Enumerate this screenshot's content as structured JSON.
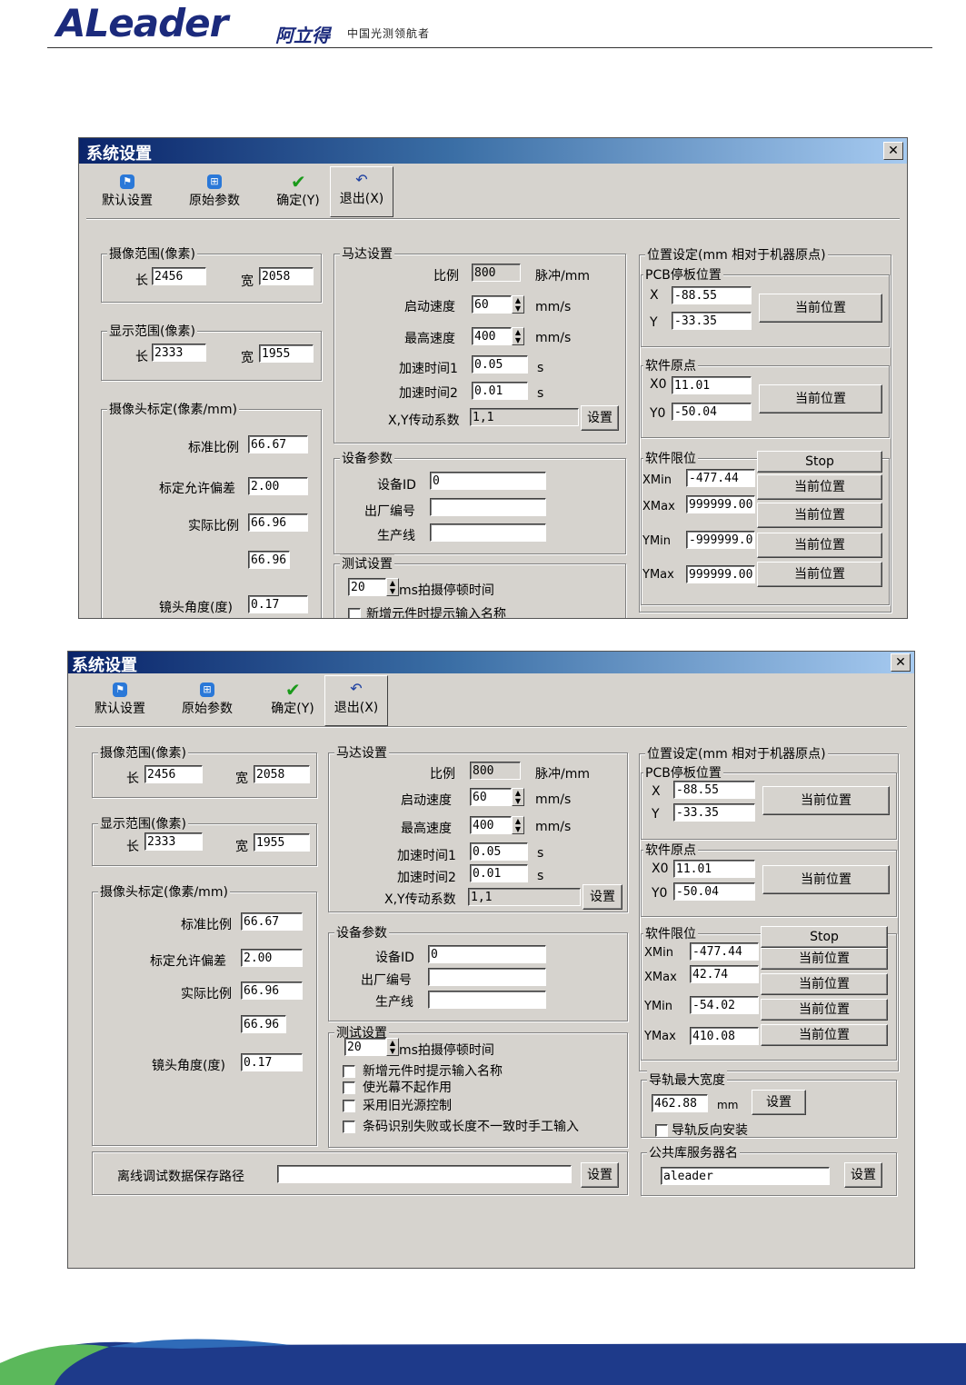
{
  "header": {
    "logo": "ALeader",
    "brand_cn": "阿立得",
    "tagline": "中国光测领航者"
  },
  "win1": {
    "title": "系统设置",
    "close": "✕",
    "toolbar": {
      "default_label": "默认设置",
      "original_label": "原始参数",
      "confirm_label": "确定(Y)",
      "exit_label": "退出(X)"
    },
    "camera_range": {
      "title": "摄像范围(像素)",
      "len_label": "长",
      "len_value": "2456",
      "wid_label": "宽",
      "wid_value": "2058"
    },
    "display_range": {
      "title": "显示范围(像素)",
      "len_label": "长",
      "len_value": "2333",
      "wid_label": "宽",
      "wid_value": "1955"
    },
    "calib": {
      "title": "摄像头标定(像素/mm)",
      "std_label": "标准比例",
      "std_value": "66.67",
      "tol_label": "标定允许偏差",
      "tol_value": "2.00",
      "act_label": "实际比例",
      "act_value": "66.96",
      "act2_value": "66.96",
      "angle_label": "镜头角度(度)",
      "angle_value": "0.17"
    },
    "motor": {
      "title": "马达设置",
      "ratio_label": "比例",
      "ratio_value": "800",
      "ratio_unit": "脉冲/mm",
      "start_label": "启动速度",
      "start_value": "60",
      "start_unit": "mm/s",
      "max_label": "最高速度",
      "max_value": "400",
      "max_unit": "mm/s",
      "acc1_label": "加速时间1",
      "acc1_value": "0.05",
      "acc1_unit": "s",
      "acc2_label": "加速时间2",
      "acc2_value": "0.01",
      "acc2_unit": "s",
      "xy_label": "X,Y传动系数",
      "xy_value": "1,1",
      "set_label": "设置"
    },
    "device": {
      "title": "设备参数",
      "id_label": "设备ID",
      "id_value": "0",
      "serial_label": "出厂编号",
      "serial_value": "",
      "line_label": "生产线",
      "line_value": ""
    },
    "test": {
      "title": "测试设置",
      "pause_value": "20",
      "pause_label": "ms拍摄停顿时间",
      "cb1": "新增元件时提示输入名称"
    },
    "position": {
      "title": "位置设定(mm 相对于机器原点)",
      "pcb_title": "PCB停板位置",
      "x_label": "X",
      "x_value": "-88.55",
      "y_label": "Y",
      "y_value": "-33.35",
      "cur_label": "当前位置",
      "origin_title": "软件原点",
      "x0_label": "X0",
      "x0_value": "11.01",
      "y0_label": "Y0",
      "y0_value": "-50.04",
      "limit_title": "软件限位",
      "stop_label": "Stop",
      "xmin_label": "XMin",
      "xmin_value": "-477.44",
      "xmax_label": "XMax",
      "xmax_value": "999999.00",
      "ymin_label": "YMin",
      "ymin_value": "-999999.0",
      "ymax_label": "YMax",
      "ymax_value": "999999.00"
    }
  },
  "win2": {
    "title": "系统设置",
    "close": "✕",
    "toolbar": {
      "default_label": "默认设置",
      "original_label": "原始参数",
      "confirm_label": "确定(Y)",
      "exit_label": "退出(X)"
    },
    "camera_range": {
      "title": "摄像范围(像素)",
      "len_label": "长",
      "len_value": "2456",
      "wid_label": "宽",
      "wid_value": "2058"
    },
    "display_range": {
      "title": "显示范围(像素)",
      "len_label": "长",
      "len_value": "2333",
      "wid_label": "宽",
      "wid_value": "1955"
    },
    "calib": {
      "title": "摄像头标定(像素/mm)",
      "std_label": "标准比例",
      "std_value": "66.67",
      "tol_label": "标定允许偏差",
      "tol_value": "2.00",
      "act_label": "实际比例",
      "act_value": "66.96",
      "act2_value": "66.96",
      "angle_label": "镜头角度(度)",
      "angle_value": "0.17"
    },
    "motor": {
      "title": "马达设置",
      "ratio_label": "比例",
      "ratio_value": "800",
      "ratio_unit": "脉冲/mm",
      "start_label": "启动速度",
      "start_value": "60",
      "start_unit": "mm/s",
      "max_label": "最高速度",
      "max_value": "400",
      "max_unit": "mm/s",
      "acc1_label": "加速时间1",
      "acc1_value": "0.05",
      "acc1_unit": "s",
      "acc2_label": "加速时间2",
      "acc2_value": "0.01",
      "acc2_unit": "s",
      "xy_label": "X,Y传动系数",
      "xy_value": "1,1",
      "set_label": "设置"
    },
    "device": {
      "title": "设备参数",
      "id_label": "设备ID",
      "id_value": "0",
      "serial_label": "出厂编号",
      "serial_value": "",
      "line_label": "生产线",
      "line_value": ""
    },
    "test": {
      "title": "测试设置",
      "pause_value": "20",
      "pause_label": "ms拍摄停顿时间",
      "cb1": "新增元件时提示输入名称",
      "cb2": "使光幕不起作用",
      "cb3": "采用旧光源控制",
      "cb4": "条码识别失败或长度不一致时手工输入"
    },
    "offline": {
      "label": "离线调试数据保存路径",
      "value": "",
      "set_label": "设置"
    },
    "position": {
      "title": "位置设定(mm 相对于机器原点)",
      "pcb_title": "PCB停板位置",
      "x_label": "X",
      "x_value": "-88.55",
      "y_label": "Y",
      "y_value": "-33.35",
      "cur_label": "当前位置",
      "origin_title": "软件原点",
      "x0_label": "X0",
      "x0_value": "11.01",
      "y0_label": "Y0",
      "y0_value": "-50.04",
      "limit_title": "软件限位",
      "stop_label": "Stop",
      "xmin_label": "XMin",
      "xmin_value": "-477.44",
      "xmax_label": "XMax",
      "xmax_value": "42.74",
      "ymin_label": "YMin",
      "ymin_value": "-54.02",
      "ymax_label": "YMax",
      "ymax_value": "410.08"
    },
    "rail": {
      "title": "导轨最大宽度",
      "value": "462.88",
      "unit": "mm",
      "set_label": "设置",
      "reverse_label": "导轨反向安装"
    },
    "server": {
      "title": "公共库服务器名",
      "value": "aleader",
      "set_label": "设置"
    }
  }
}
